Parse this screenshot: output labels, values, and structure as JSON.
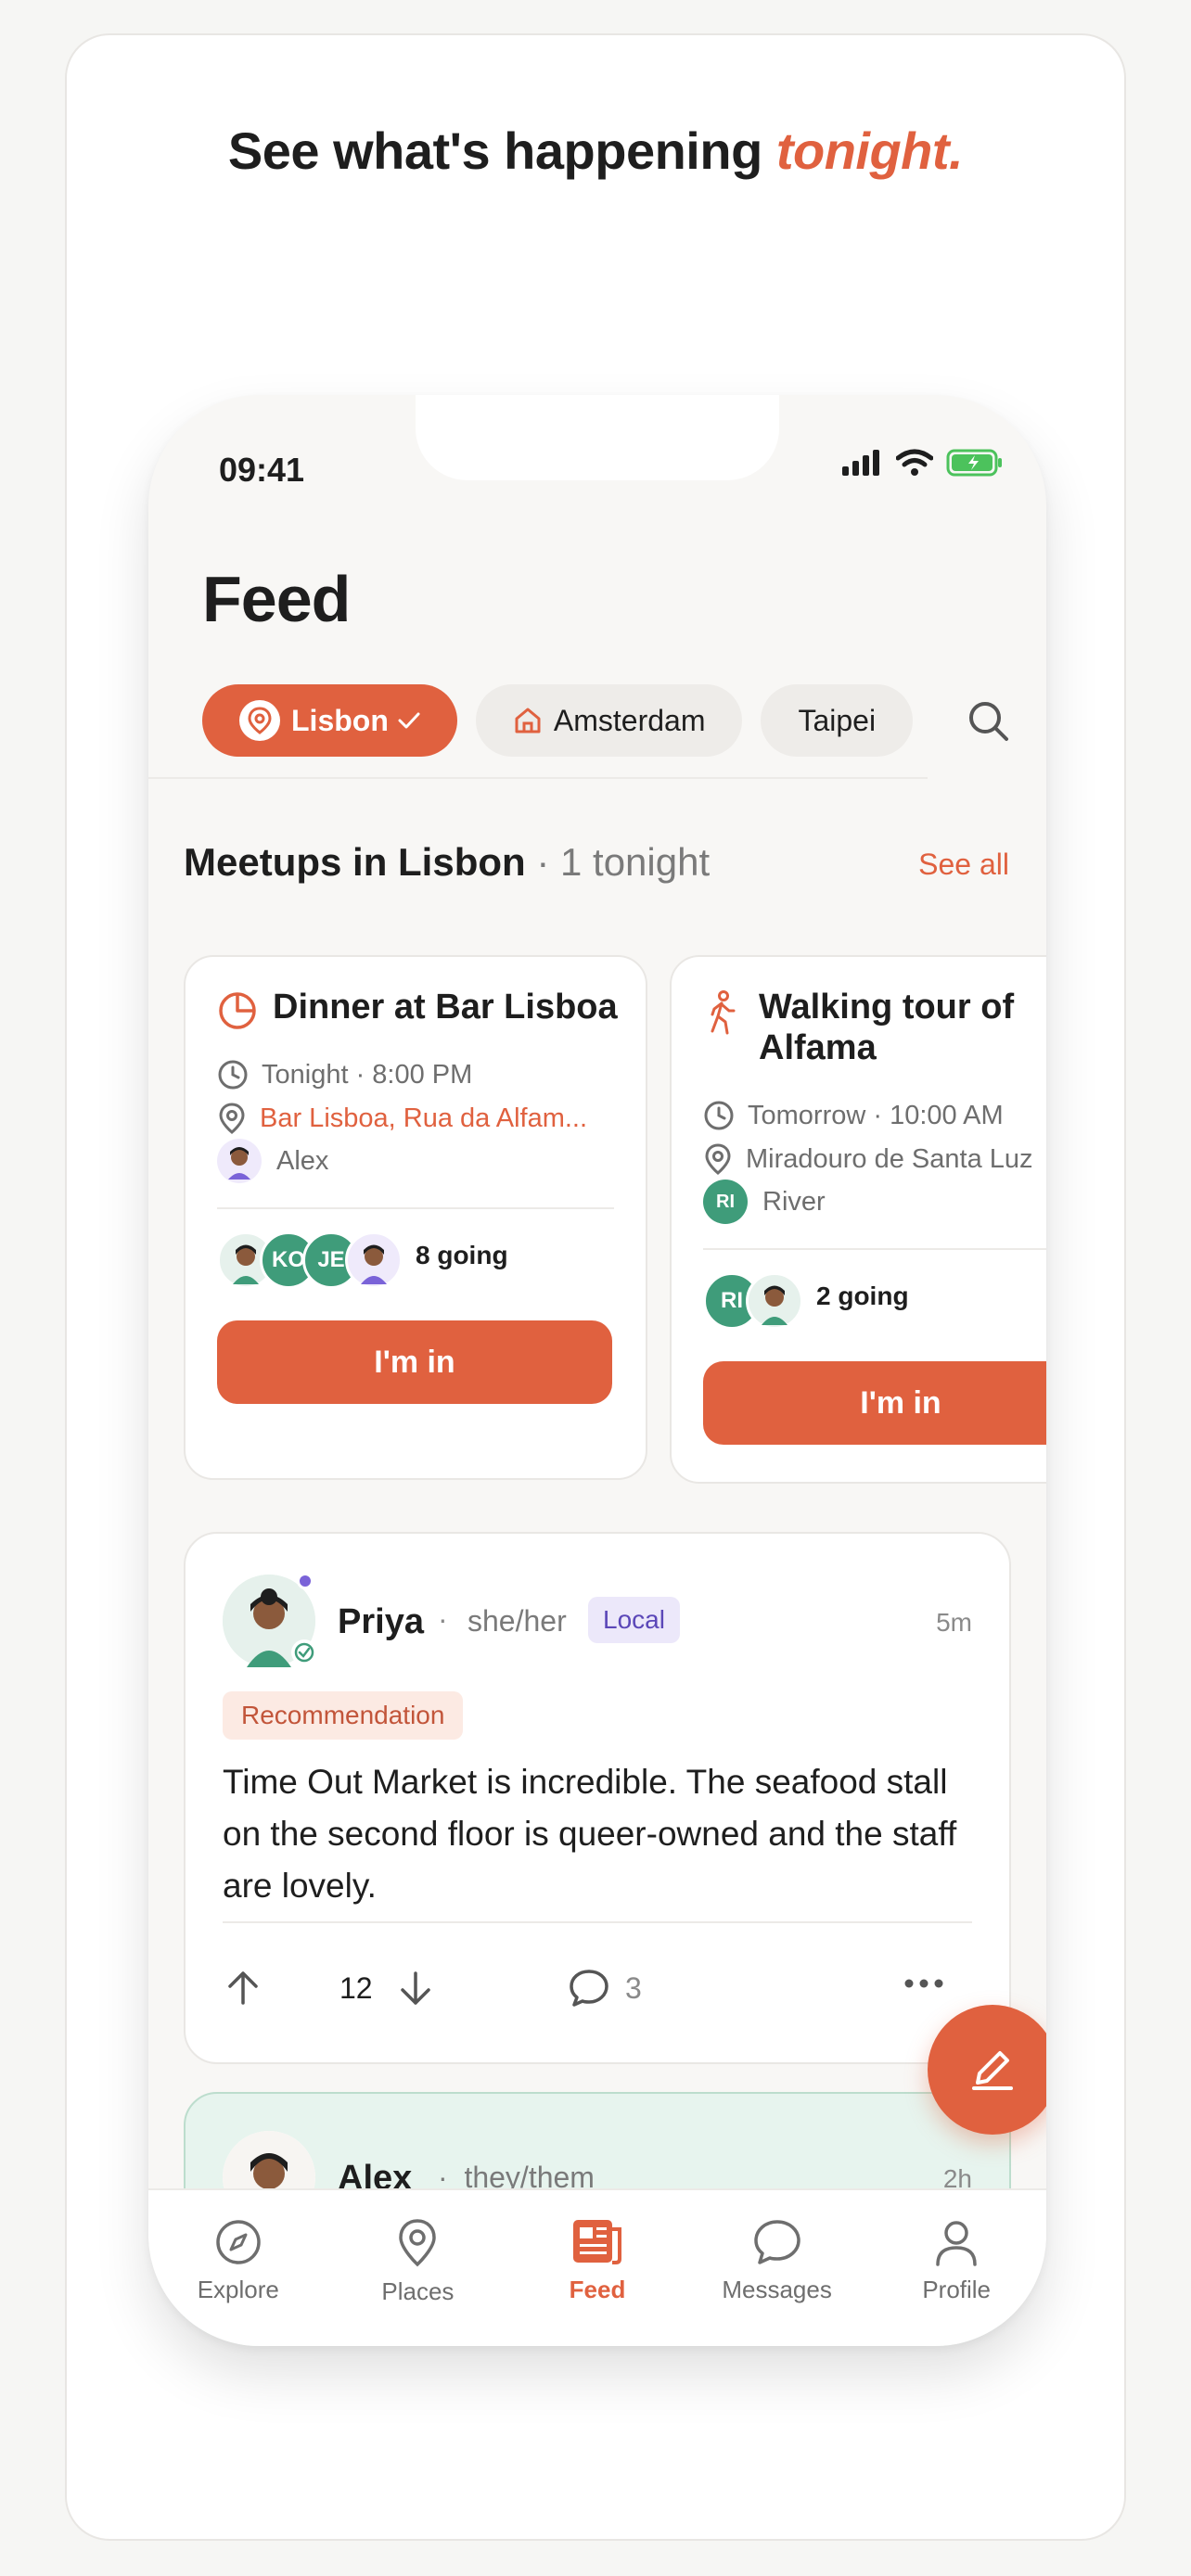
{
  "headline": {
    "text": "See what's happening ",
    "accent": "tonight."
  },
  "status": {
    "time": "09:41"
  },
  "feed": {
    "title": "Feed",
    "chips": [
      {
        "label": "Lisbon",
        "active": true
      },
      {
        "label": "Amsterdam",
        "active": false
      },
      {
        "label": "Taipei",
        "active": false
      }
    ]
  },
  "meetups": {
    "heading": "Meetups in Lisbon",
    "count": " · 1 tonight",
    "see_all": "See all",
    "items": [
      {
        "title": "Dinner at Bar Lisboa",
        "time": "Tonight · 8:00 PM",
        "location": "Bar Lisboa, Rua da Alfam...",
        "host": "Alex",
        "going": "8 going",
        "attendees": [
          "KO",
          "JE"
        ],
        "cta": "I'm in"
      },
      {
        "title_line1": "Walking tour of",
        "title_line2": "Alfama",
        "time": "Tomorrow · 10:00 AM",
        "location": "Miradouro de Santa Luz",
        "host": "River",
        "host_initials": "RI",
        "going": "2 going",
        "attendees": [
          "RI"
        ],
        "cta": "I'm in"
      }
    ]
  },
  "post": {
    "name": "Priya",
    "sep": "·",
    "pronouns": "she/her",
    "badge": "Local",
    "time": "5m",
    "tag": "Recommendation",
    "body": "Time Out Market is incredible. The seafood stall on the second floor is queer-owned and the staff are lovely.",
    "score": "12",
    "comments": "3"
  },
  "post2": {
    "name": "Alex",
    "sep": "·",
    "pronouns": "they/them",
    "time": "2h"
  },
  "tabs": [
    {
      "label": "Explore",
      "icon": "compass-icon"
    },
    {
      "label": "Places",
      "icon": "map-pin-icon"
    },
    {
      "label": "Feed",
      "icon": "newspaper-icon",
      "active": true
    },
    {
      "label": "Messages",
      "icon": "chat-bubble-icon"
    },
    {
      "label": "Profile",
      "icon": "person-icon"
    }
  ],
  "colors": {
    "accent": "#E0613F",
    "green": "#3F9C7A",
    "purple": "#7A63D8"
  }
}
